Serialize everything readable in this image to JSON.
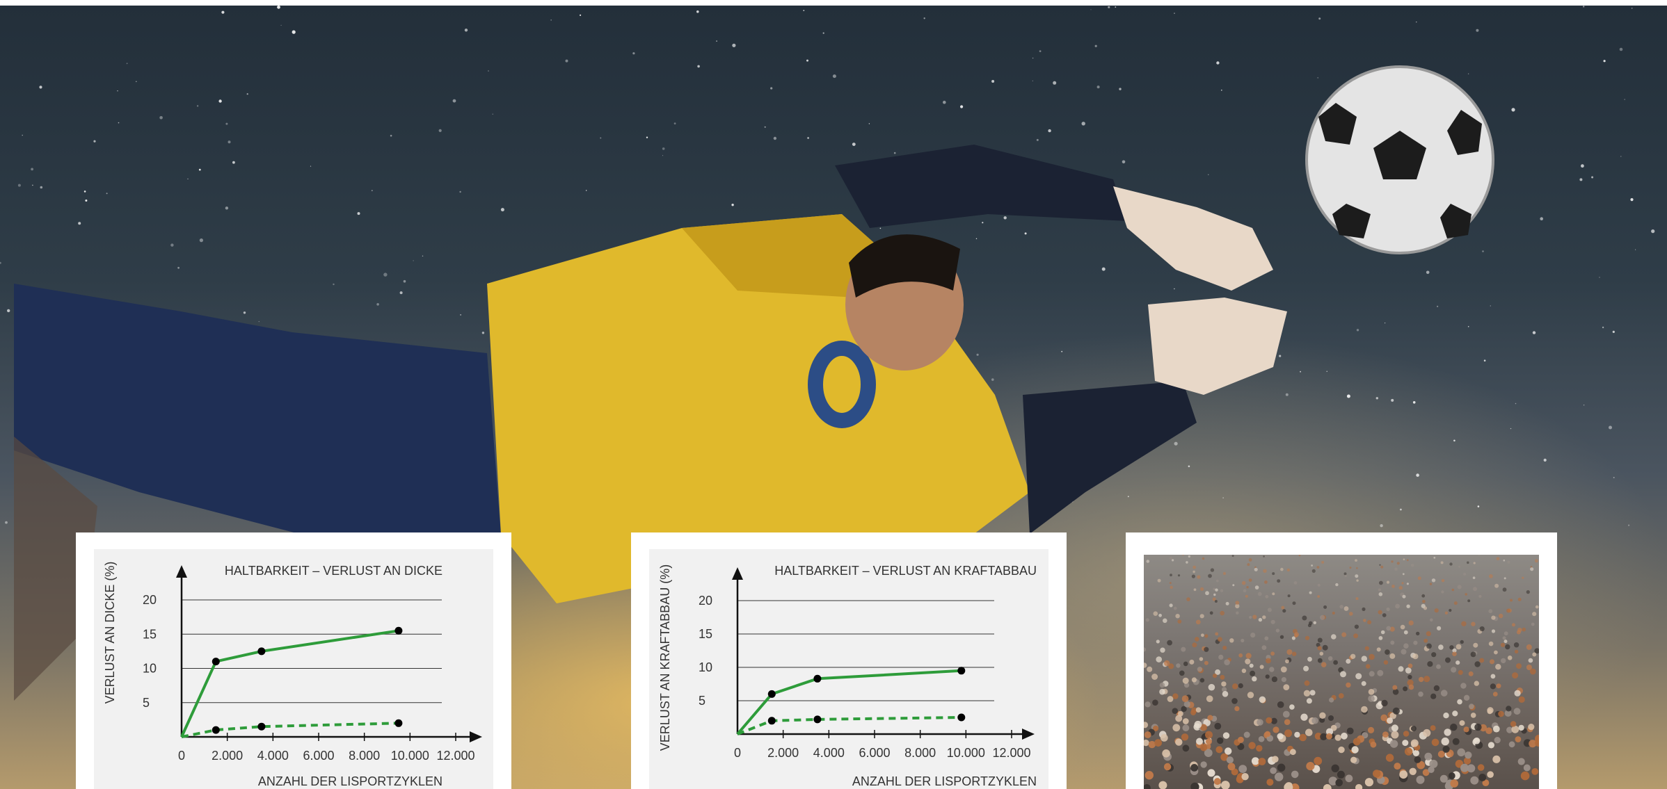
{
  "hero": {
    "image": "goalkeeper-diving-for-soccer-ball"
  },
  "colors": {
    "series": "#2e9c3a",
    "grid": "#333333",
    "panel": "#f1f1f1",
    "axis": "#111111"
  },
  "charts": [
    {
      "id": "left"
    },
    {
      "id": "middle"
    }
  ],
  "chart_data": [
    {
      "type": "line",
      "title": "HALTBARKEIT – VERLUST AN DICKE",
      "xlabel": "ANZAHL DER LISPORTZYKLEN",
      "ylabel": "VERLUST AN DICKE (%)",
      "xticks": [
        "0",
        "2.000",
        "4.000",
        "6.000",
        "8.000",
        "10.000",
        "12.000"
      ],
      "yticks": [
        "5",
        "10",
        "15",
        "20"
      ],
      "xlim": [
        0,
        12000
      ],
      "ylim": [
        0,
        20
      ],
      "grid": true,
      "series": [
        {
          "style": "solid",
          "x": [
            0,
            1500,
            3500,
            9500
          ],
          "y": [
            0,
            11,
            12.5,
            15.5
          ]
        },
        {
          "style": "dashed",
          "x": [
            0,
            1500,
            3500,
            9500
          ],
          "y": [
            0,
            1,
            1.5,
            2
          ]
        }
      ]
    },
    {
      "type": "line",
      "title": "HALTBARKEIT – VERLUST AN KRAFTABBAU",
      "xlabel": "ANZAHL DER LISPORTZYKLEN",
      "ylabel": "VERLUST AN KRAFTABBAU (%)",
      "xticks": [
        "0",
        "2.000",
        "4.000",
        "6.000",
        "8.000",
        "10.000",
        "12.000"
      ],
      "yticks": [
        "5",
        "10",
        "15",
        "20"
      ],
      "xlim": [
        0,
        12000
      ],
      "ylim": [
        0,
        20
      ],
      "grid": true,
      "series": [
        {
          "style": "solid",
          "x": [
            0,
            1500,
            3500,
            9800
          ],
          "y": [
            0,
            6,
            8.3,
            9.5
          ]
        },
        {
          "style": "dashed",
          "x": [
            0,
            1500,
            3500,
            9800
          ],
          "y": [
            0,
            2,
            2.2,
            2.5
          ]
        }
      ]
    }
  ],
  "photo": {
    "image": "rubber-granulate-surface-closeup"
  }
}
